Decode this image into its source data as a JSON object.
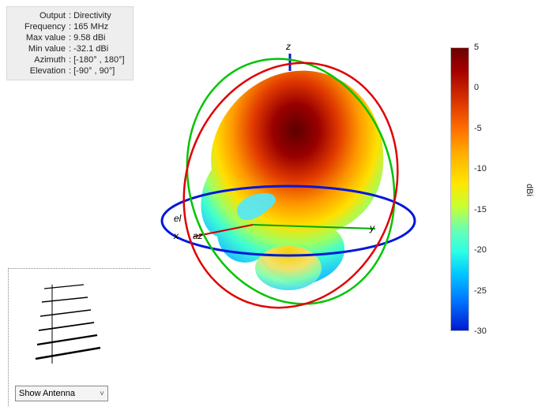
{
  "info": {
    "labels": {
      "output": "Output",
      "frequency": "Frequency",
      "max": "Max value",
      "min": "Min value",
      "azimuth": "Azimuth",
      "elevation": "Elevation"
    },
    "output": "Directivity",
    "frequency": "165 MHz",
    "max": "9.58 dBi",
    "min": "-32.1 dBi",
    "azimuth": "[-180° , 180°]",
    "elevation": "[-90° , 90°]"
  },
  "axes": {
    "x": "x",
    "y": "y",
    "z": "z",
    "az": "az",
    "el": "el"
  },
  "colorbar": {
    "unit": "dBi",
    "min": -30,
    "max": 5,
    "ticks": [
      5,
      0,
      -5,
      -10,
      -15,
      -20,
      -25,
      -30
    ]
  },
  "chart_data": {
    "type": "3d-radiation-pattern",
    "output_quantity": "Directivity",
    "frequency_mhz": 165,
    "value_unit": "dBi",
    "value_range": {
      "min": -32.1,
      "max": 9.58
    },
    "azimuth_span_deg": [
      -180,
      180
    ],
    "elevation_span_deg": [
      -90,
      90
    ],
    "colorbar_scale": {
      "min": -30,
      "max": 5,
      "ticks": [
        5,
        0,
        -5,
        -10,
        -15,
        -20,
        -25,
        -30
      ]
    },
    "axes_shown": [
      "x",
      "y",
      "z",
      "az",
      "el"
    ],
    "orbit_rings": [
      {
        "color": "blue",
        "plane": "az (xy)"
      },
      {
        "color": "green",
        "plane": "yz"
      },
      {
        "color": "red",
        "plane": "xz"
      }
    ],
    "note": "Continuous 3D lobe colored by directivity; front upper lobe near max (≈9.6 dBi, dark red) tapering through orange/yellow/green to cyan/blue in lower rear region."
  },
  "dropdown": {
    "selected": "Show Antenna"
  }
}
